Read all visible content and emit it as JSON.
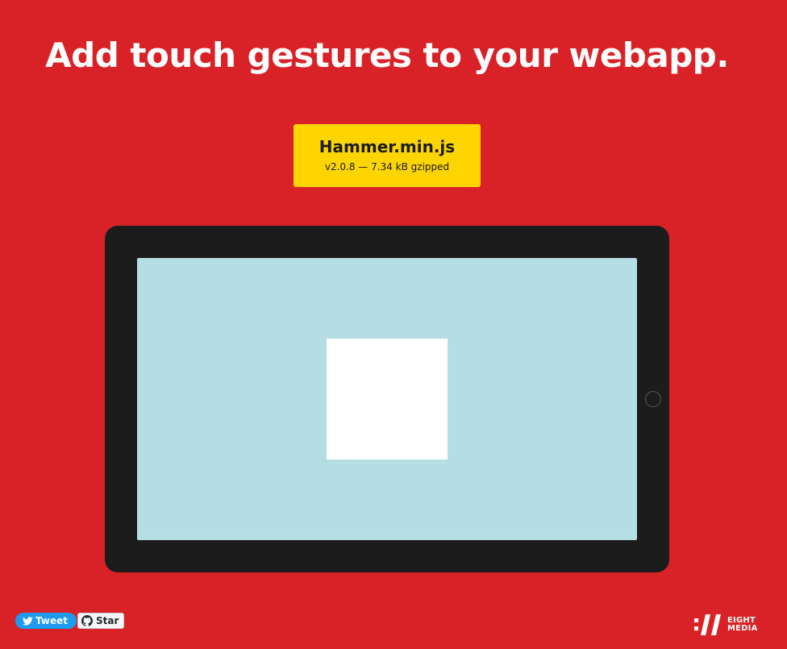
{
  "page": {
    "headline": "Add touch gestures to your webapp."
  },
  "download": {
    "title": "Hammer.min.js",
    "meta": "v2.0.8 — 7.34 kB gzipped"
  },
  "colors": {
    "background": "#d92128",
    "download_button": "#ffd500",
    "tablet_frame": "#1c1c1c",
    "tablet_screen": "#b5dde4",
    "gesture_target": "#ffffff",
    "tweet_button": "#1d9bf0"
  },
  "social": {
    "tweet_label": "Tweet",
    "tweet_icon": "twitter-bird-icon",
    "star_label": "Star",
    "star_icon": "github-octocat-icon"
  },
  "brand": {
    "logo_icon": "eight-media-slashes-logo",
    "line1": "EIGHT",
    "line2": "MEDIA"
  }
}
